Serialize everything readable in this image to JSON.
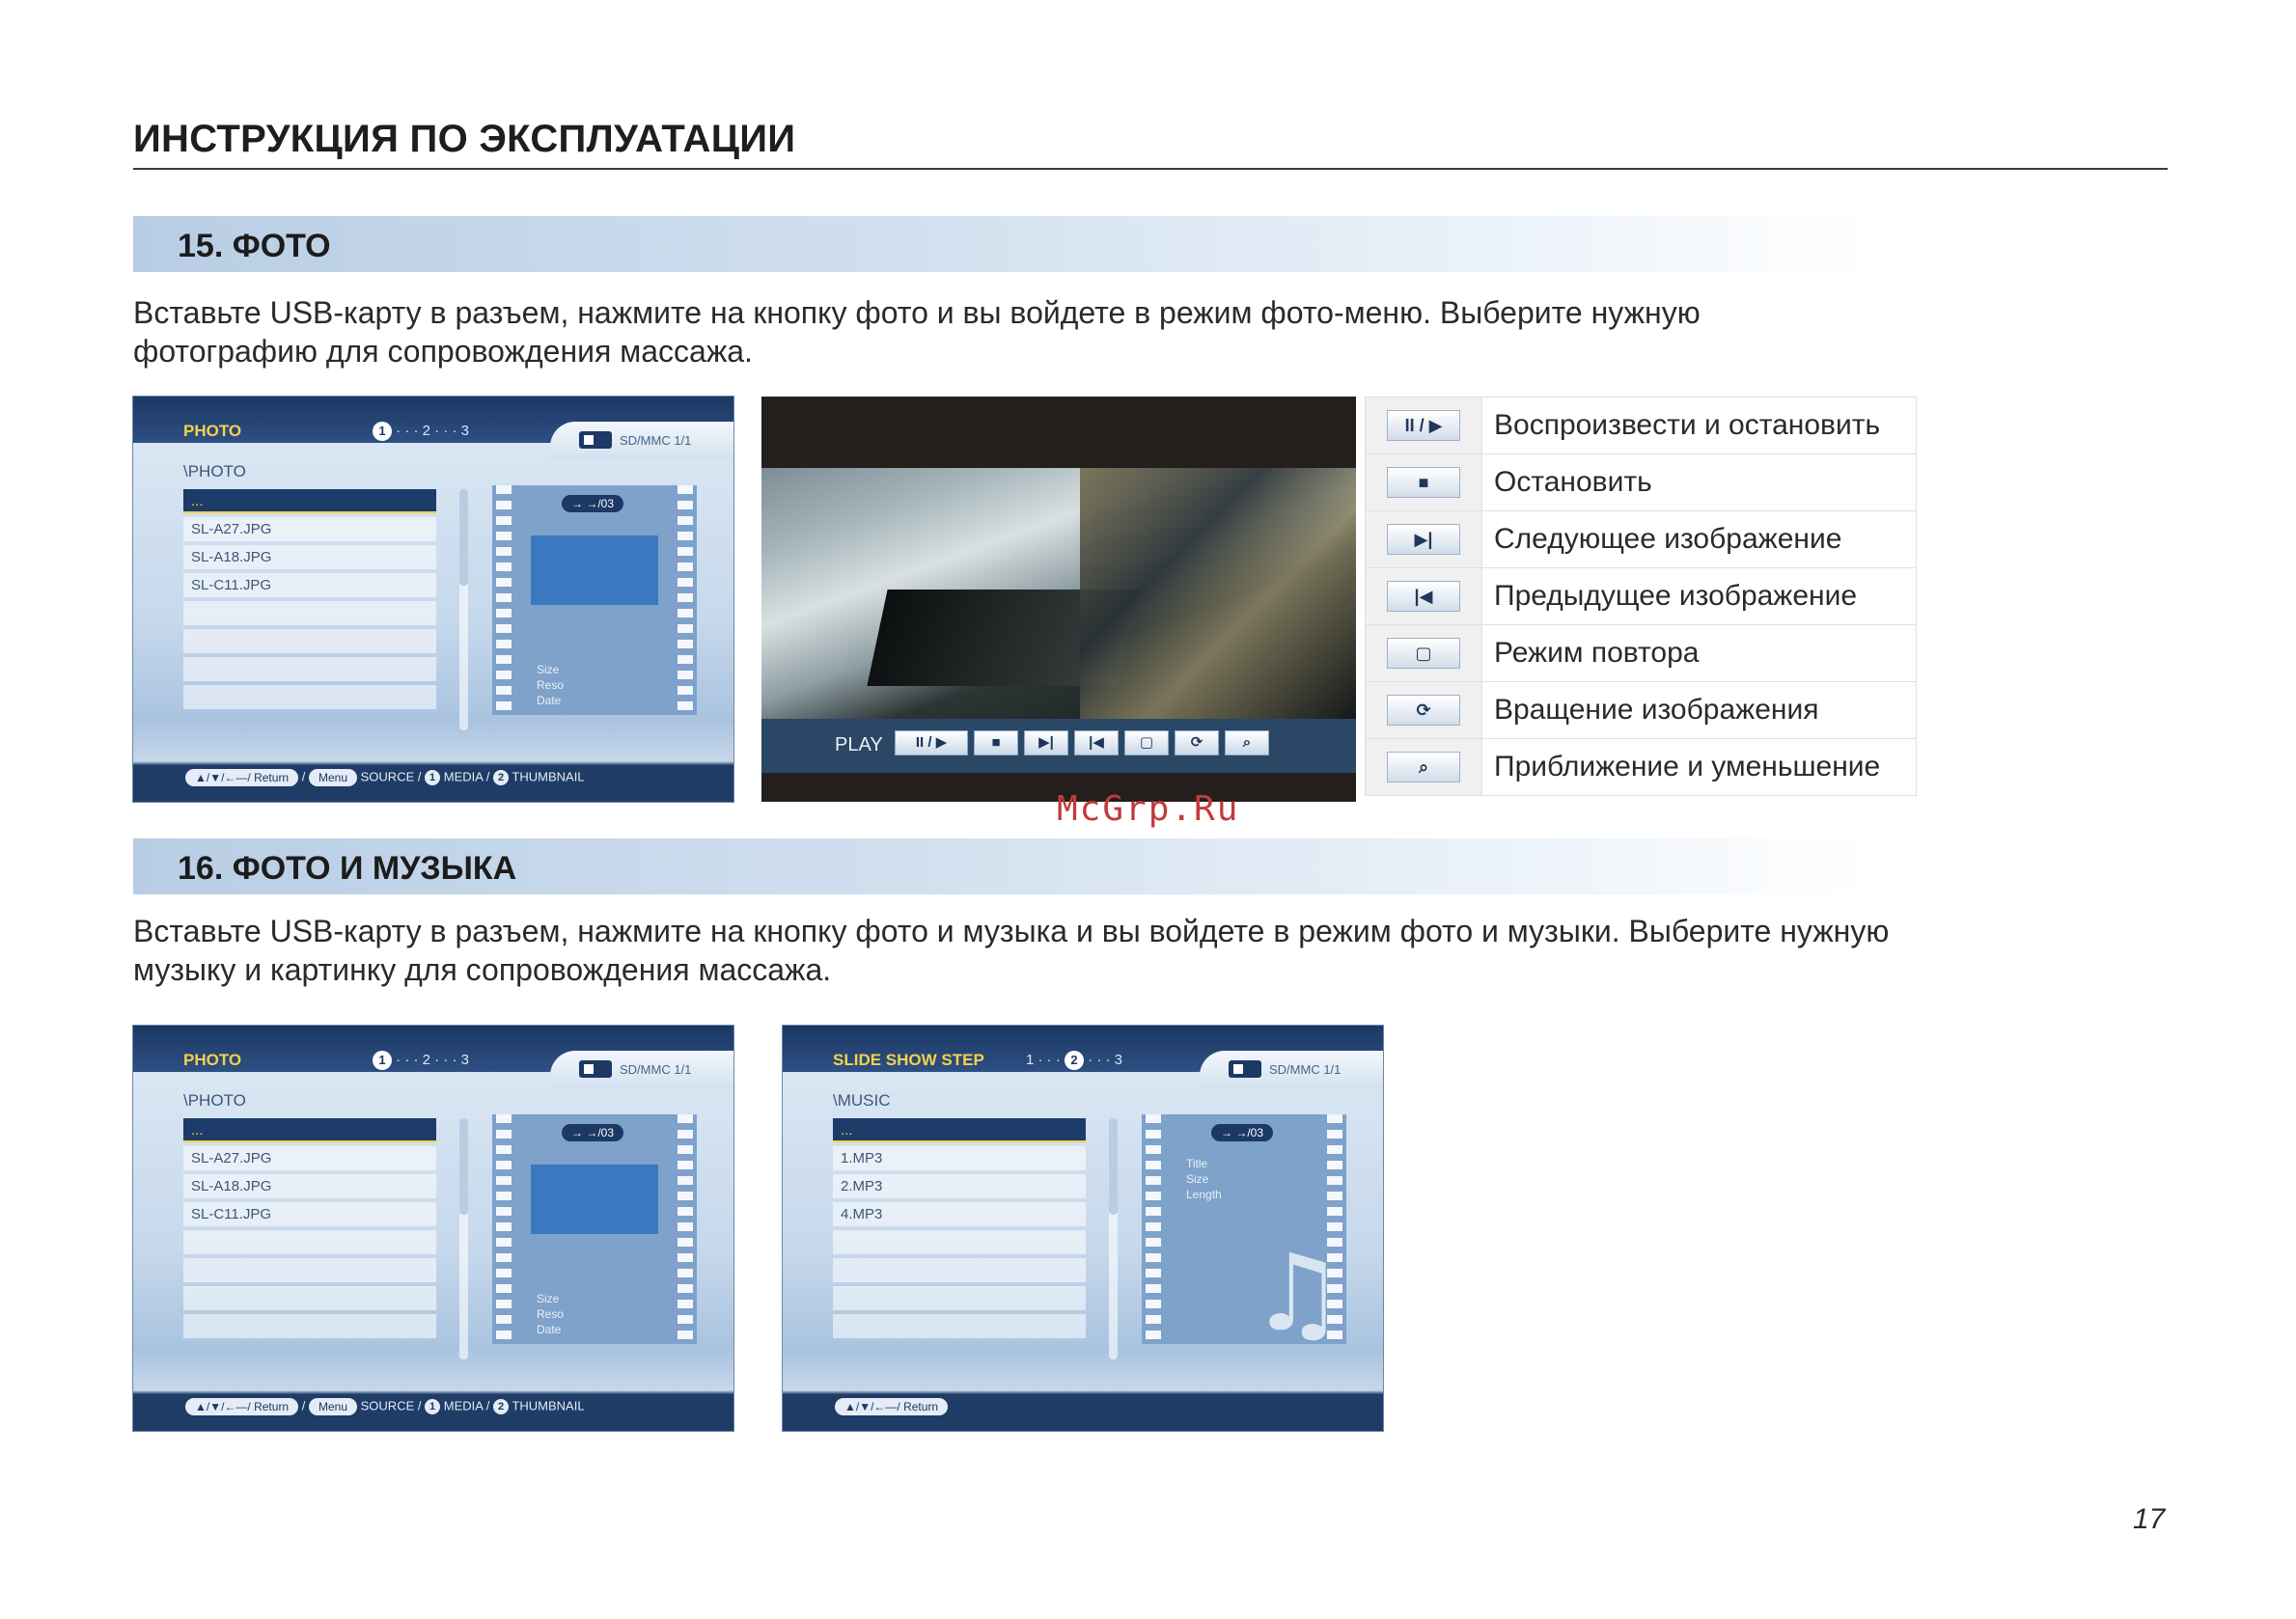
{
  "header": {
    "title": "ИНСТРУКЦИЯ ПО ЭКСПЛУАТАЦИИ"
  },
  "section15": {
    "title": "15. ФОТО",
    "text_line1": "Вставьте USB-карту в разъем, нажмите на кнопку фото и вы войдете в режим фото-меню. Выберите нужную",
    "text_line2": "фотографию для сопровождения массажа."
  },
  "photo_screen": {
    "brand": "PHOTO",
    "step1": "1",
    "steps_rest": "· · · 2 · · · 3",
    "card_label": "SD/MMC 1/1",
    "folder": "\\PHOTO",
    "files": [
      "...",
      "SL-A27.JPG",
      "SL-A18.JPG",
      "SL-C11.JPG",
      "",
      "",
      "",
      ""
    ],
    "badge": "→ →/03",
    "meta": [
      "Size",
      "Reso",
      "Date"
    ],
    "bottom": {
      "nav": "▲/▼/←—/ Return",
      "sep1": "/",
      "menu": "Menu",
      "source": "SOURCE /",
      "media_num": "1",
      "media": "MEDIA /",
      "thumb_num": "2",
      "thumb": "THUMBNAIL"
    }
  },
  "video": {
    "play_label": "PLAY",
    "buttons": [
      "II / ▶",
      "■",
      "▶|",
      "|◀",
      "▢",
      "⟳",
      "⌕"
    ]
  },
  "controls": [
    {
      "icon": "II / ▶",
      "icon_name": "play-pause-icon",
      "label": "Воспроизвести и остановить"
    },
    {
      "icon": "■",
      "icon_name": "stop-icon",
      "label": "Остановить"
    },
    {
      "icon": "▶|",
      "icon_name": "next-icon",
      "label": "Следующее изображение"
    },
    {
      "icon": "|◀",
      "icon_name": "previous-icon",
      "label": "Предыдущее изображение"
    },
    {
      "icon": "▢",
      "icon_name": "repeat-icon",
      "label": "Режим повтора"
    },
    {
      "icon": "⟳",
      "icon_name": "rotate-icon",
      "label": "Вращение изображения"
    },
    {
      "icon": "⌕",
      "icon_name": "zoom-icon",
      "label": "Приближение и уменьшение"
    }
  ],
  "watermark": "McGrp.Ru",
  "section16": {
    "title": "16. ФОТО И МУЗЫКА",
    "text_line1": "Вставьте USB-карту в разъем, нажмите на кнопку фото и музыка и вы войдете в режим фото и музыки. Выберите нужную",
    "text_line2": "музыку и картинку  для сопровождения массажа."
  },
  "music_screen": {
    "brand": "SLIDE SHOW STEP",
    "steps_pre": "1 · · · ",
    "step2": "2",
    "steps_post": " · · · 3",
    "card_label": "SD/MMC 1/1",
    "folder": "\\MUSIC",
    "files": [
      "...",
      "1.MP3",
      "2.MP3",
      "4.MP3",
      "",
      "",
      "",
      ""
    ],
    "badge": "→ →/03",
    "meta": [
      "Title",
      "Size",
      "Length"
    ],
    "bottom": {
      "nav": "▲/▼/←—/ Return"
    }
  },
  "page_number": "17"
}
